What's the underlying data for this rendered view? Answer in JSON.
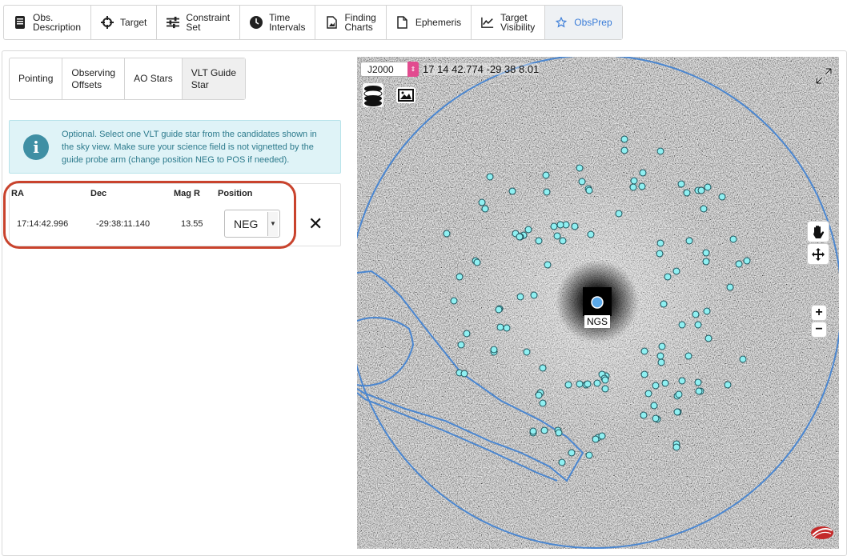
{
  "top_tabs": [
    {
      "label": "Obs.\nDescription",
      "icon": "document-icon"
    },
    {
      "label": "Target",
      "icon": "crosshair-icon"
    },
    {
      "label": "Constraint\nSet",
      "icon": "sliders-icon"
    },
    {
      "label": "Time\nIntervals",
      "icon": "clock-icon"
    },
    {
      "label": "Finding\nCharts",
      "icon": "image-file-icon"
    },
    {
      "label": "Ephemeris",
      "icon": "file-icon"
    },
    {
      "label": "Target\nVisibility",
      "icon": "line-chart-icon"
    },
    {
      "label": "ObsPrep",
      "icon": "star-outline-icon",
      "active": true
    }
  ],
  "sub_tabs": [
    {
      "label": "Pointing"
    },
    {
      "label": "Observing\nOffsets"
    },
    {
      "label": "AO Stars"
    },
    {
      "label": "VLT Guide\nStar",
      "active": true
    }
  ],
  "info": {
    "text": "Optional. Select one VLT guide star from the candidates shown in the sky view. Make sure your science field is not vignetted by the guide probe arm (change position NEG to POS if needed)."
  },
  "guide_table": {
    "headers": {
      "ra": "RA",
      "dec": "Dec",
      "mag": "Mag R",
      "position": "Position"
    },
    "row": {
      "ra": "17:14:42.996",
      "dec": "-29:38:11.140",
      "mag": "13.55",
      "position": "NEG"
    }
  },
  "sky_view": {
    "frame": "J2000",
    "coordinates": "17 14 42.774 -29 38 8.01",
    "target_label": "NGS",
    "colors": {
      "candidate": "#8ff0f2",
      "overlay": "#4a86d0",
      "target": "#5aa9ea",
      "pink": "#e24b8f"
    }
  },
  "zoom": {
    "in": "+",
    "out": "−"
  }
}
